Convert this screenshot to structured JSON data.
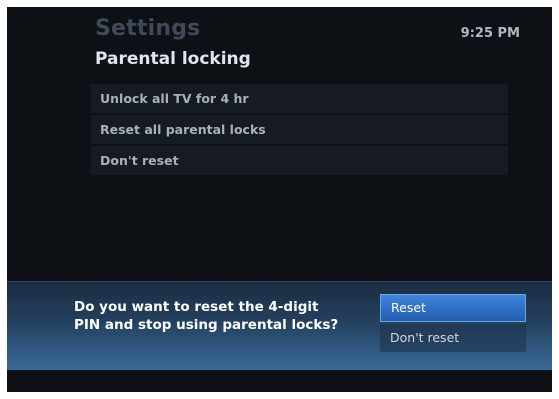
{
  "header": {
    "app_title": "Settings",
    "clock": "9:25 PM",
    "page_title": "Parental locking"
  },
  "menu": {
    "items": [
      {
        "label": "Unlock all TV for 4 hr"
      },
      {
        "label": "Reset all parental locks"
      },
      {
        "label": "Don't reset"
      }
    ]
  },
  "dialog": {
    "question_line1": "Do you want to reset the 4-digit",
    "question_line2": "PIN and stop using parental locks?",
    "options": [
      {
        "label": "Reset",
        "selected": true
      },
      {
        "label": "Don't reset",
        "selected": false
      }
    ]
  },
  "colors": {
    "background": "#0d1015",
    "menu_item": "#161b23",
    "highlight": "#2d6fc3",
    "dialog_band": "#24405e"
  }
}
